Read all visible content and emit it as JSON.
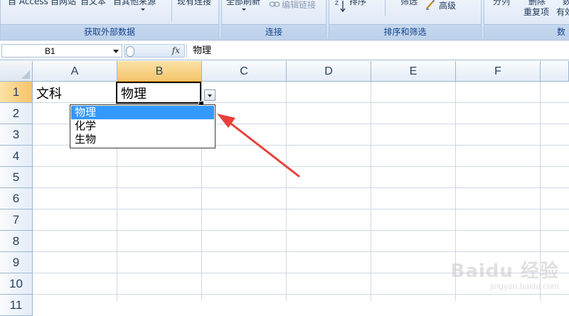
{
  "ribbon": {
    "external_data": {
      "label": "获取外部数据",
      "from_access": "自 Access",
      "from_web": "自网站",
      "from_text": "自文本",
      "from_other": "自其他来源",
      "existing_connections": "现有连接"
    },
    "connections": {
      "label": "连接",
      "refresh_all": "全部刷新",
      "edit_links": "编辑链接"
    },
    "sort_filter": {
      "label": "排序和筛选",
      "sort": "排序",
      "filter": "筛选",
      "advanced": "高级"
    },
    "data_tools": {
      "split": "分列",
      "remove_dup": "删除",
      "duplicates": "重复项",
      "valid": "数",
      "valid2": "有效"
    }
  },
  "formula_bar": {
    "name_box": "B1",
    "fx": "fx",
    "content": "物理"
  },
  "sheet": {
    "columns": [
      "A",
      "B",
      "C",
      "D",
      "E",
      "F"
    ],
    "rows": [
      "1",
      "2",
      "3",
      "4",
      "5",
      "6",
      "7",
      "8",
      "9",
      "10",
      "11"
    ],
    "a1": "文科",
    "b1": "物理"
  },
  "dropdown": {
    "options": [
      "物理",
      "化学",
      "生物"
    ],
    "selected": "物理"
  },
  "watermark": {
    "logo": "Baidu 经验",
    "url": "jingyan.baidu.com"
  },
  "colors": {
    "selection_highlight": "#3399ff",
    "annotation_arrow": "#e8403a",
    "active_header": "#f5c46b",
    "ribbon_label": "#15428b"
  }
}
